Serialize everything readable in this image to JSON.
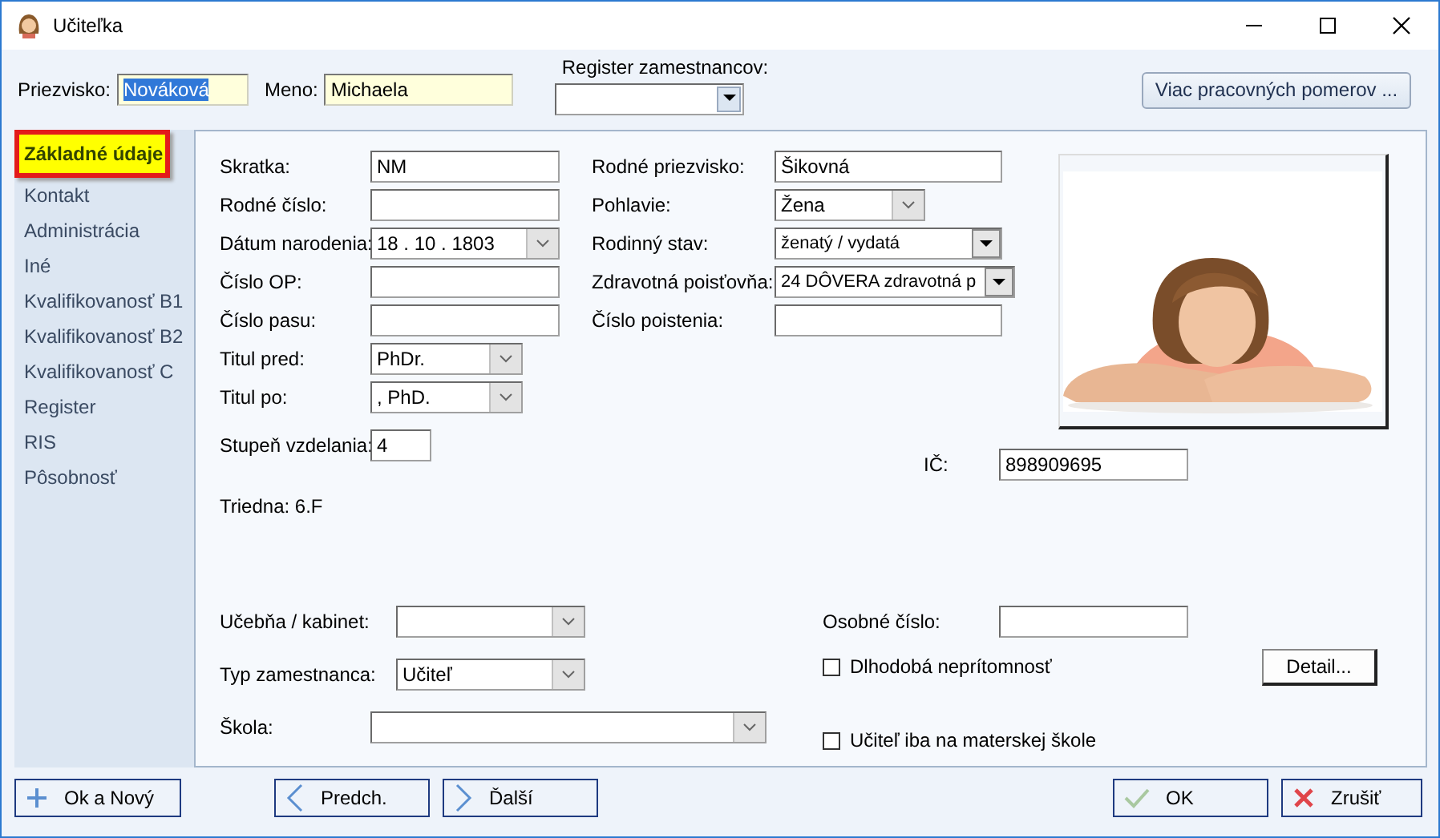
{
  "window": {
    "title": "Učiteľka"
  },
  "header": {
    "surname": {
      "label": "Priezvisko:",
      "value": "Nováková",
      "selected": true
    },
    "name": {
      "label": "Meno:",
      "value": "Michaela",
      "selected": false
    },
    "register": {
      "label": "Register zamestnancov:",
      "kind": "dropdown"
    },
    "more_button": "Viac pracovných pomerov ..."
  },
  "sidebar": {
    "items": [
      {
        "label": "Základné údaje",
        "selected": true
      },
      {
        "label": "Kontakt",
        "selected": false
      },
      {
        "label": "Administrácia",
        "selected": false
      },
      {
        "label": "Iné",
        "selected": false
      },
      {
        "label": "Kvalifikovanosť B1",
        "selected": false
      },
      {
        "label": "Kvalifikovanosť B2",
        "selected": false
      },
      {
        "label": "Kvalifikovanosť C",
        "selected": false
      },
      {
        "label": "Register",
        "selected": false
      },
      {
        "label": "RIS",
        "selected": false
      },
      {
        "label": "Pôsobnosť",
        "selected": false
      }
    ]
  },
  "basic": {
    "left_fields": [
      {
        "label": "Skratka:",
        "value": "NM",
        "kind": "text"
      },
      {
        "label": "Rodné číslo:",
        "kind": "text"
      },
      {
        "label": "Dátum narodenia:",
        "value": "18  .  10  .  1803",
        "kind": "combo"
      },
      {
        "label": "Číslo OP:",
        "kind": "text"
      },
      {
        "label": "Číslo pasu:",
        "kind": "text"
      },
      {
        "label": "Titul pred:",
        "value": "PhDr.",
        "kind": "combo"
      },
      {
        "label": "Titul po:",
        "value": ", PhD.",
        "kind": "combo"
      },
      {
        "label": "Stupeň vzdelania:",
        "value": "4",
        "kind": "text"
      }
    ],
    "class_info": "Triedna: 6.F",
    "mid_fields": [
      {
        "label": "Rodné priezvisko:",
        "value": "Šikovná",
        "kind": "text"
      },
      {
        "label": "Pohlavie:",
        "value": "Žena",
        "kind": "combo"
      },
      {
        "label": "Rodinný stav:",
        "value": "ženatý / vydatá",
        "kind": "dropdown"
      },
      {
        "label": "Zdravotná poisťovňa:",
        "value": "24 DÔVERA zdravotná p",
        "kind": "dropdown"
      },
      {
        "label": "Číslo poistenia:",
        "kind": "text"
      }
    ],
    "ic": {
      "label": "IČ:",
      "value": "898909695"
    }
  },
  "lower": {
    "left_fields": [
      {
        "label": "Učebňa / kabinet:",
        "kind": "combo"
      },
      {
        "label": "Typ zamestnanca:",
        "value": "Učiteľ",
        "kind": "combo"
      },
      {
        "label": "Škola:",
        "kind": "combo"
      }
    ],
    "personal_number": {
      "label": "Osobné číslo:"
    },
    "checkboxes": [
      {
        "label": "Dlhodobá neprítomnosť",
        "checked": false
      },
      {
        "label": "Učiteľ iba na materskej škole",
        "checked": false
      }
    ],
    "detail_button": "Detail..."
  },
  "footer": {
    "buttons": [
      {
        "label": "Ok a Nový",
        "kind": "plus"
      },
      {
        "label": "Predch.",
        "kind": "prev"
      },
      {
        "label": "Ďalší",
        "kind": "next"
      },
      {
        "label": "OK",
        "kind": "ok"
      },
      {
        "label": "Zrušiť",
        "kind": "cancel"
      }
    ]
  }
}
